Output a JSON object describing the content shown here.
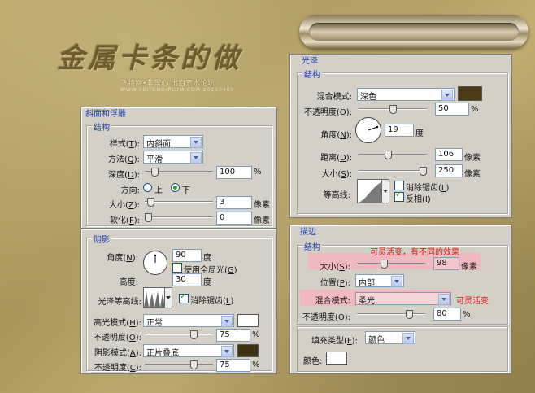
{
  "artwork": {
    "title": "金属卡条的做",
    "credit": "飞特网•非常心  出自云水论坛",
    "credit_url": "WWW.FEITENG/PLUM.COM  20110409"
  },
  "bevel": {
    "panel_title": "斜面和浮雕",
    "structure_title": "结构",
    "style_label": "样式(",
    "style_key": "T",
    "style_value": "内斜面",
    "technique_label": "方法(",
    "technique_key": "Q",
    "technique_value": "平滑",
    "depth_label": "深度(",
    "depth_key": "D",
    "depth_value": "100",
    "depth_unit": "%",
    "depth_fraction": 0.1,
    "direction_label": "方向:",
    "direction_up": "上",
    "direction_down": "下",
    "direction_selected": "down",
    "size_label": "大小(",
    "size_key": "Z",
    "size_value": "3",
    "size_unit": "像素",
    "size_fraction": 0.04,
    "soften_label": "软化(",
    "soften_key": "F",
    "soften_value": "0",
    "soften_unit": "像素",
    "soften_fraction": 0.0
  },
  "shading": {
    "title": "阴影",
    "angle_label": "角度(",
    "angle_key": "N",
    "angle_value": "90",
    "angle_unit": "度",
    "global_light_label": "使用全局光(",
    "global_light_key": "G",
    "global_light_checked": false,
    "altitude_label": "高度:",
    "altitude_value": "30",
    "altitude_unit": "度",
    "gloss_contour_label": "光泽等高线:",
    "antialias_label": "消除锯齿(",
    "antialias_key": "L",
    "antialias_checked": true,
    "highlight_mode_label": "高光模式(",
    "highlight_mode_key": "H",
    "highlight_mode_value": "正常",
    "highlight_color": "#ffffff",
    "highlight_opacity_label": "不透明度(",
    "highlight_opacity_key": "O",
    "highlight_opacity_value": "75",
    "highlight_opacity_unit": "%",
    "highlight_opacity_fraction": 0.75,
    "shadow_mode_label": "阴影模式(",
    "shadow_mode_key": "A",
    "shadow_mode_value": "正片叠底",
    "shadow_color": "#3e3212",
    "shadow_opacity_label": "不透明度(",
    "shadow_opacity_key": "C",
    "shadow_opacity_value": "75",
    "shadow_opacity_unit": "%",
    "shadow_opacity_fraction": 0.75
  },
  "satin": {
    "panel_title": "光泽",
    "structure_title": "结构",
    "blend_label": "混合模式:",
    "blend_value": "深色",
    "color": "#4a3a18",
    "opacity_label": "不透明度(",
    "opacity_key": "O",
    "opacity_value": "50",
    "opacity_unit": "%",
    "opacity_fraction": 0.5,
    "angle_label": "角度(",
    "angle_key": "N",
    "angle_value": "19",
    "angle_unit": "度",
    "distance_label": "距离(",
    "distance_key": "D",
    "distance_value": "106",
    "distance_unit": "像素",
    "distance_fraction": 0.42,
    "size_label": "大小(",
    "size_key": "S",
    "size_value": "250",
    "size_unit": "像素",
    "size_fraction": 1.0,
    "contour_label": "等高线:",
    "antialias_label": "消除锯齿(",
    "antialias_key": "L",
    "antialias_checked": false,
    "invert_label": "反相(",
    "invert_key": "I",
    "invert_checked": true
  },
  "stroke": {
    "panel_title": "描边",
    "structure_title": "结构",
    "size_label": "大小(",
    "size_key": "S",
    "size_value": "98",
    "size_unit": "像素",
    "size_fraction": 0.39,
    "size_note": "可灵活变，有不同的效果",
    "position_label": "位置(",
    "position_key": "P",
    "position_value": "内部",
    "blend_label": "混合模式:",
    "blend_value": "柔光",
    "blend_note": "可灵活变",
    "opacity_label": "不透明度(",
    "opacity_key": "O",
    "opacity_value": "80",
    "opacity_unit": "%",
    "opacity_fraction": 0.8,
    "fill_type_label": "填充类型(",
    "fill_type_key": "F",
    "fill_type_value": "颜色",
    "color_label": "颜色:",
    "color": "#ffffff"
  }
}
